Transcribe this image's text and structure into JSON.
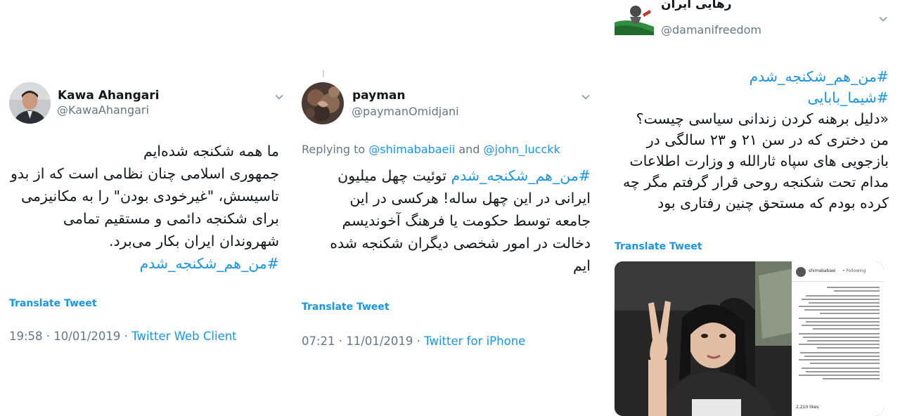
{
  "tweet1": {
    "author_name": "Kawa Ahangari",
    "author_handle": "@KawaAhangari",
    "body_lines": [
      "ما همه شکنجه شده‌ایم",
      "جمهوری اسلامی چنان نظامی است که از بدو",
      "تاسیسش، \"غیرخودی بودن\" را به مکانیزمی",
      "برای شکنجه دائمی و مستقیم تمامی",
      "شهروندان ایران بکار می‌برد."
    ],
    "hashtag": "#من_هم_شکنجه_شدم",
    "translate_label": "Translate Tweet",
    "time": "19:58 · 10/01/2019 · ",
    "source": "Twitter Web Client"
  },
  "tweet2": {
    "author_name": "payman",
    "author_handle": "@paymanOmidjani",
    "reply_prefix": "Replying to ",
    "reply_mention_1": "@shimababaeii",
    "reply_and": " and ",
    "reply_mention_2": "@john_lucckk",
    "hashtag": "#من_هم_شکنجه_شدم",
    "first_line_rest": " توئیت چهل میلیون",
    "body_lines": [
      "ایرانی در این چهل ساله! هرکسی در این",
      "جامعه توسط حکومت یا فرهنگ آخوندیسم",
      "دخالت در امور شخصی دیگران شکنجه شده",
      "ایم"
    ],
    "translate_label": "Translate Tweet",
    "time": "07:21 · 11/01/2019 · ",
    "source": "Twitter for iPhone"
  },
  "tweet3": {
    "author_name": "رهایی ایران",
    "author_handle": "@damanifreedom",
    "hashtags": [
      "#من_هم_شکنجه_شدم",
      "#شیما_بابایی"
    ],
    "body_lines": [
      "«دلیل برهنه کردن زندانی سیاسی چیست؟",
      "من دختری که در سن ۲۱ و ۲۳ سالگی در",
      "بازجویی های سپاه ثارالله و وزارت اطلاعات",
      "مدام تحت شکنجه روحی قرار گرفتم مگر چه",
      "کرده بودم که مستحق چنین رفتاری بود"
    ],
    "translate_label": "Translate Tweet",
    "media": {
      "insta_user": "shimababaei",
      "insta_follow": "• Following",
      "likes": "2,210 likes"
    }
  },
  "colors": {
    "link": "#1b95e0",
    "muted": "#657786",
    "text": "#14171a"
  }
}
